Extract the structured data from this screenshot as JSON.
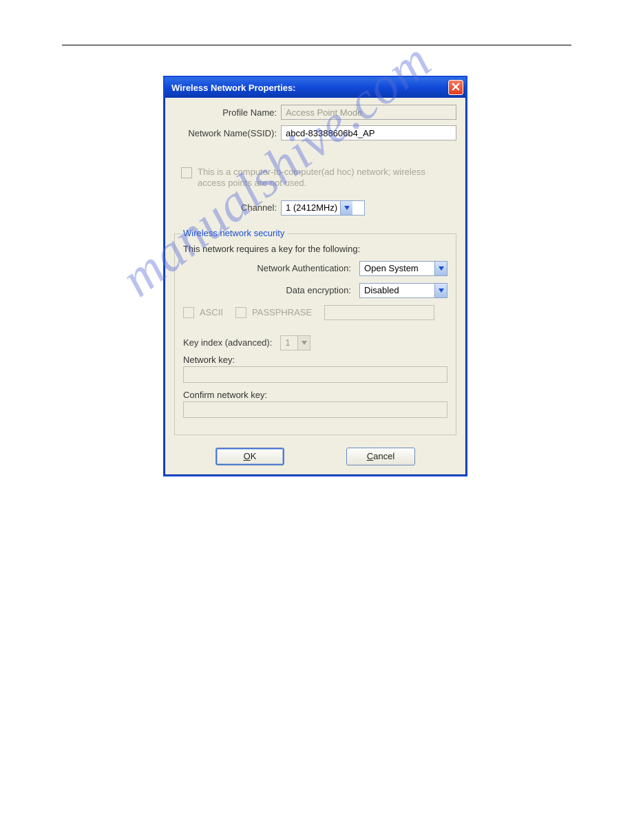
{
  "dialog": {
    "title": "Wireless Network Properties:",
    "profile_label": "Profile Name:",
    "profile_value": "Access Point Mode",
    "ssid_label": "Network Name(SSID):",
    "ssid_value": "abcd-83388606b4_AP",
    "adhoc_text": "This is a computer-to-computer(ad hoc) network; wireless access points are not used.",
    "channel_label": "Channel:",
    "channel_value": "1  (2412MHz)",
    "security": {
      "legend": "Wireless network security",
      "desc": "This network requires a key for the following:",
      "auth_label": "Network Authentication:",
      "auth_value": "Open System",
      "enc_label": "Data encryption:",
      "enc_value": "Disabled",
      "ascii_label": "ASCII",
      "pass_label": "PASSPHRASE",
      "keyidx_label": "Key index (advanced):",
      "keyidx_value": "1",
      "netkey_label": "Network key:",
      "confirm_label": "Confirm network key:"
    },
    "ok_label": "OK",
    "cancel_label": "Cancel"
  },
  "watermark": "manualshive.com"
}
